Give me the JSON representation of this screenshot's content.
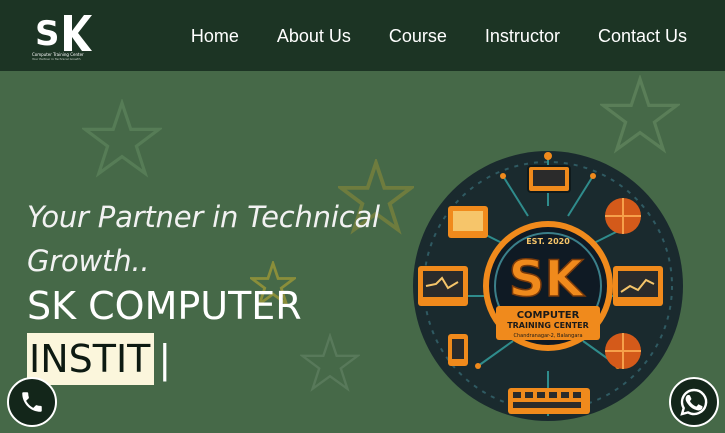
{
  "brand": {
    "logo_letters": "SK",
    "logo_caption": "Computer Training Center",
    "logo_tagline": "Your Partner in Technical Growth"
  },
  "nav": {
    "items": [
      {
        "label": "Home"
      },
      {
        "label": "About Us"
      },
      {
        "label": "Course"
      },
      {
        "label": "Instructor"
      },
      {
        "label": "Contact Us"
      }
    ]
  },
  "hero": {
    "tagline": "Your Partner in Technical Growth..",
    "title_line1": "SK COMPUTER",
    "title_line2_typed": "INSTIT",
    "cursor": "|"
  },
  "emblem": {
    "est": "EST. 2020",
    "letters": "SK",
    "line1": "COMPUTER",
    "line2": "TRAINING CENTER",
    "address": "Chandranagar-2, Balangara"
  },
  "colors": {
    "navbar": "#1c3424",
    "hero_bg": "#466948",
    "highlight": "#fbf6dc",
    "accent_orange": "#f08a1c"
  },
  "icons": {
    "call": "phone-icon",
    "whatsapp": "whatsapp-icon"
  }
}
